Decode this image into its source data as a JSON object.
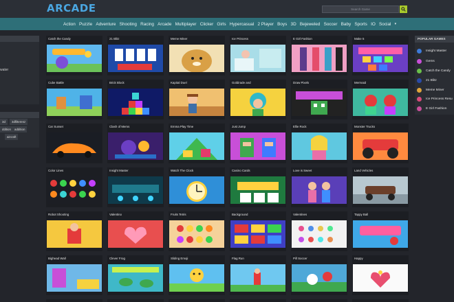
{
  "header": {
    "logo": "ARCADE",
    "search_placeholder": "Search Game"
  },
  "nav": {
    "items": [
      "Action",
      "Puzzle",
      "Adventure",
      "Shooting",
      "Racing",
      "Arcade",
      "Multiplayer",
      "Clicker",
      "Girls",
      "Hypercasual",
      "2 Player",
      "Boys",
      "3D",
      "Bejeweled",
      "Soccer",
      "Baby",
      "Sports",
      "IO",
      "Social"
    ],
    "more_icon": "caret-down-icon"
  },
  "left_panel": {
    "fragment_text": "water",
    "tags": [
      "3d",
      "3dfilterenz",
      "ddition",
      "addition",
      "aircraft"
    ]
  },
  "right_panel": {
    "title": "POPULAR GAMES",
    "items": [
      {
        "label": "Insight Master",
        "color": "#3d7bd9"
      },
      {
        "label": "Gems",
        "color": "#c94fd8"
      },
      {
        "label": "Catch the Candy",
        "color": "#6ac14a"
      },
      {
        "label": "21 Blitz",
        "color": "#2a4ba8"
      },
      {
        "label": "Meme Miner",
        "color": "#e0a43a"
      },
      {
        "label": "Ice Princess Resu",
        "color": "#d84a7a"
      },
      {
        "label": "E Girl Fashion",
        "color": "#c94f9a"
      }
    ]
  },
  "games": [
    [
      "Catch the Candy",
      "21 Blitz",
      "Meme Miner",
      "Ice Princess",
      "E Girl Fashion",
      "Make 5"
    ],
    [
      "Cube Battle",
      "Brick Block",
      "Kapital Duel",
      "Goldirade and",
      "Draw Pixels",
      "Mermaid"
    ],
    [
      "Car Sunset",
      "Clash of Mems",
      "Emma Play Time",
      "Just Jump",
      "Ellie Rock",
      "Monster Trucks"
    ],
    [
      "Color Lines",
      "Insight Master",
      "Watch The Clock",
      "Casino Cards",
      "Love is Sweet",
      "Land Vehicles"
    ],
    [
      "Robot Shooting",
      "Valentino",
      "Fruits Tetris",
      "Background",
      "Valentines",
      "Tappy Ball"
    ],
    [
      "Bighead Wall",
      "Clever Frog",
      "Sliding Emoji",
      "Flag Run",
      "Pill Soccer",
      "Happy"
    ]
  ]
}
